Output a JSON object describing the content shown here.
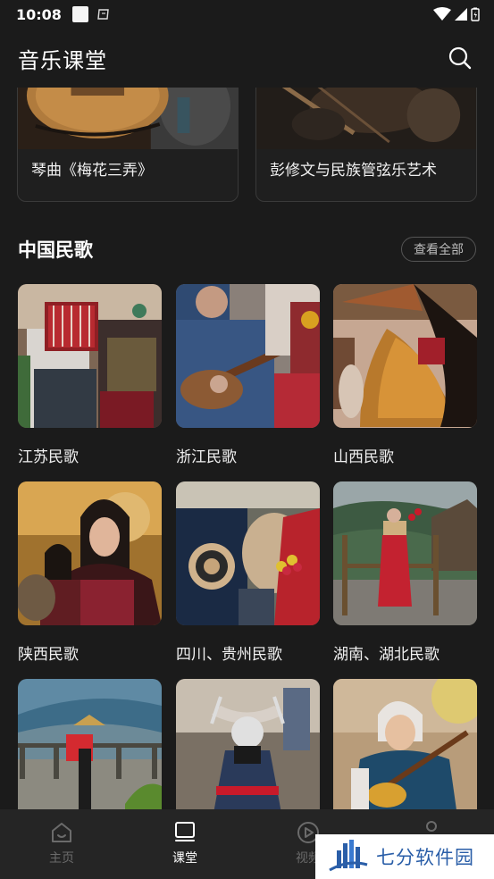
{
  "status": {
    "time": "10:08"
  },
  "app": {
    "title": "音乐课堂"
  },
  "featured": [
    {
      "title": "琴曲《梅花三弄》"
    },
    {
      "title": "彭修文与民族管弦乐艺术"
    }
  ],
  "section": {
    "title": "中国民歌",
    "see_all": "查看全部"
  },
  "folk_songs": [
    {
      "label": "江苏民歌"
    },
    {
      "label": "浙江民歌"
    },
    {
      "label": "山西民歌"
    },
    {
      "label": "陕西民歌"
    },
    {
      "label": "四川、贵州民歌"
    },
    {
      "label": "湖南、湖北民歌"
    },
    {
      "label": ""
    },
    {
      "label": ""
    },
    {
      "label": ""
    }
  ],
  "nav": [
    {
      "label": "主页",
      "icon": "home-icon"
    },
    {
      "label": "课堂",
      "icon": "classroom-icon"
    },
    {
      "label": "视频",
      "icon": "video-icon"
    },
    {
      "label": "",
      "icon": "profile-icon"
    }
  ],
  "watermark": {
    "text": "七分软件园"
  },
  "colors": {
    "background": "#1b1b1b",
    "nav_bg": "#252525",
    "active": "#ffffff",
    "inactive": "#6b6b6b",
    "watermark": "#2a5ea8"
  }
}
